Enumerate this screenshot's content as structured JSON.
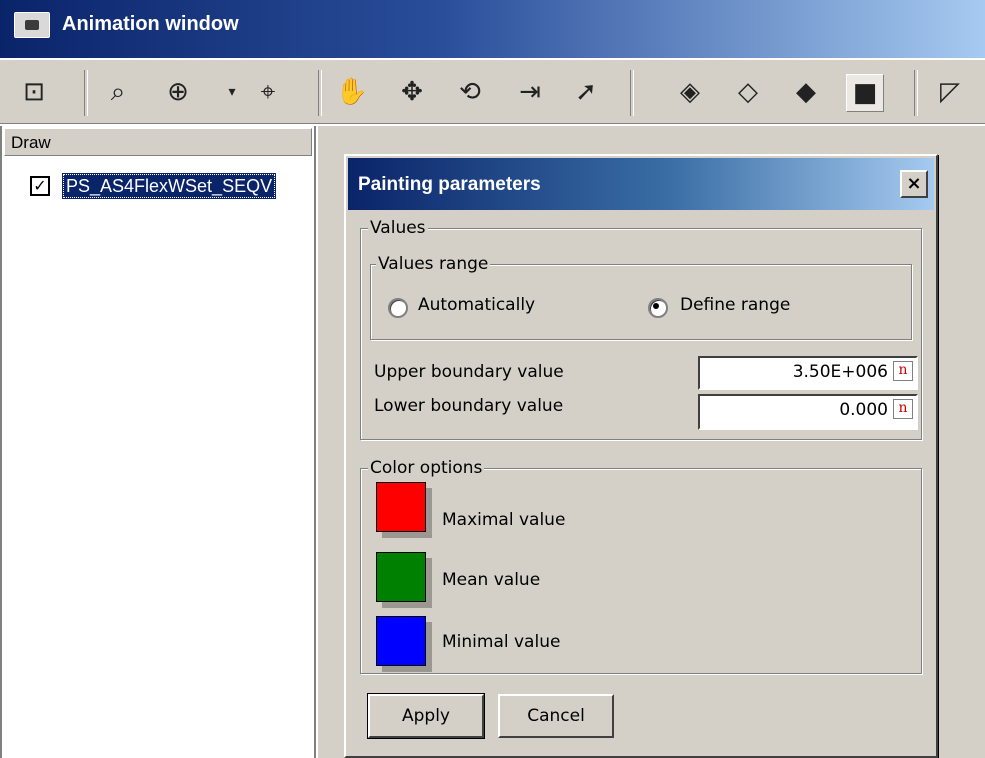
{
  "window": {
    "title": "Animation window"
  },
  "toolbar": {
    "icons": [
      "camera-icon",
      "zoom-window-icon",
      "zoom-region-icon",
      "dropdown-arrow-icon",
      "target-icon",
      "pan-hand-icon",
      "rotate-icon",
      "orbit-icon",
      "move-icon",
      "select-cursor-icon",
      "wireframe-box-icon",
      "hidden-line-box-icon",
      "shaded-box-icon",
      "solid-box-icon",
      "perspective-icon"
    ]
  },
  "left_panel": {
    "header": "Draw",
    "items": [
      {
        "label": "PS_AS4FlexWSet_SEQV",
        "checked": true
      }
    ]
  },
  "dialog": {
    "title": "Painting parameters",
    "close_symbol": "×",
    "values_group": "Values",
    "values_range_group": "Values range",
    "radio_auto": "Automatically",
    "radio_define": "Define range",
    "selected_range": "Define range",
    "upper_label": "Upper boundary value",
    "upper_value": "3.50E+006",
    "lower_label": "Lower boundary value",
    "lower_value": "0.000",
    "field_marker": "n",
    "color_group": "Color options",
    "colors": [
      {
        "label": "Maximal value",
        "color": "#ff0000"
      },
      {
        "label": "Mean value",
        "color": "#008000"
      },
      {
        "label": "Minimal value",
        "color": "#0000ff"
      }
    ],
    "apply_label": "Apply",
    "cancel_label": "Cancel"
  }
}
